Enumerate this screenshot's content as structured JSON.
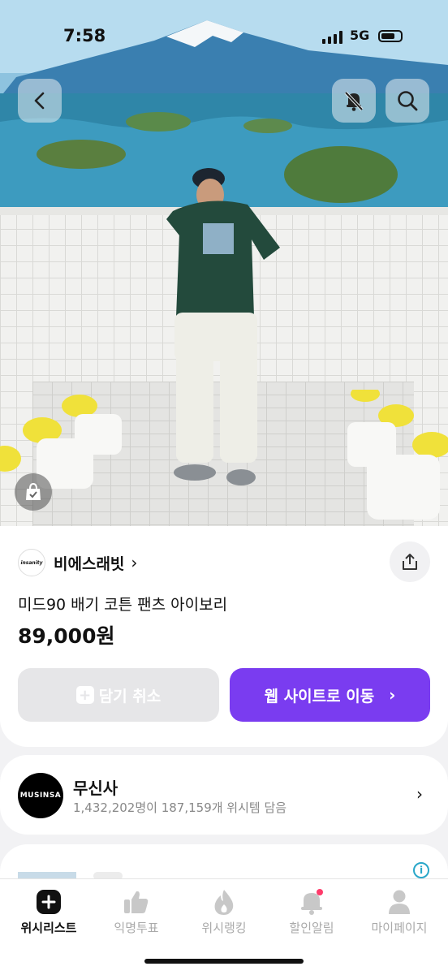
{
  "status_bar": {
    "time": "7:58",
    "network": "5G"
  },
  "product": {
    "brand": "비에스래빗",
    "brand_logo_text": "insanity",
    "name": "미드90 배기 코튼 팬츠 아이보리",
    "price": "89,000원"
  },
  "actions": {
    "cancel_label": "담기 취소",
    "web_label": "웹 사이트로 이동"
  },
  "store": {
    "logo_text": "MUSINSA",
    "name": "무신사",
    "subtitle": "1,432,202명이 187,159개 위시템 담음"
  },
  "tabs": [
    {
      "label": "위시리스트",
      "icon": "plus-square-icon",
      "active": true
    },
    {
      "label": "익명투표",
      "icon": "thumbs-up-icon",
      "active": false
    },
    {
      "label": "위시랭킹",
      "icon": "fire-icon",
      "active": false
    },
    {
      "label": "할인알림",
      "icon": "bell-icon",
      "active": false
    },
    {
      "label": "마이페이지",
      "icon": "person-icon",
      "active": false
    }
  ],
  "colors": {
    "accent": "#7a3cf0",
    "notification_dot": "#ff3b6b",
    "info": "#2aa7c9"
  }
}
